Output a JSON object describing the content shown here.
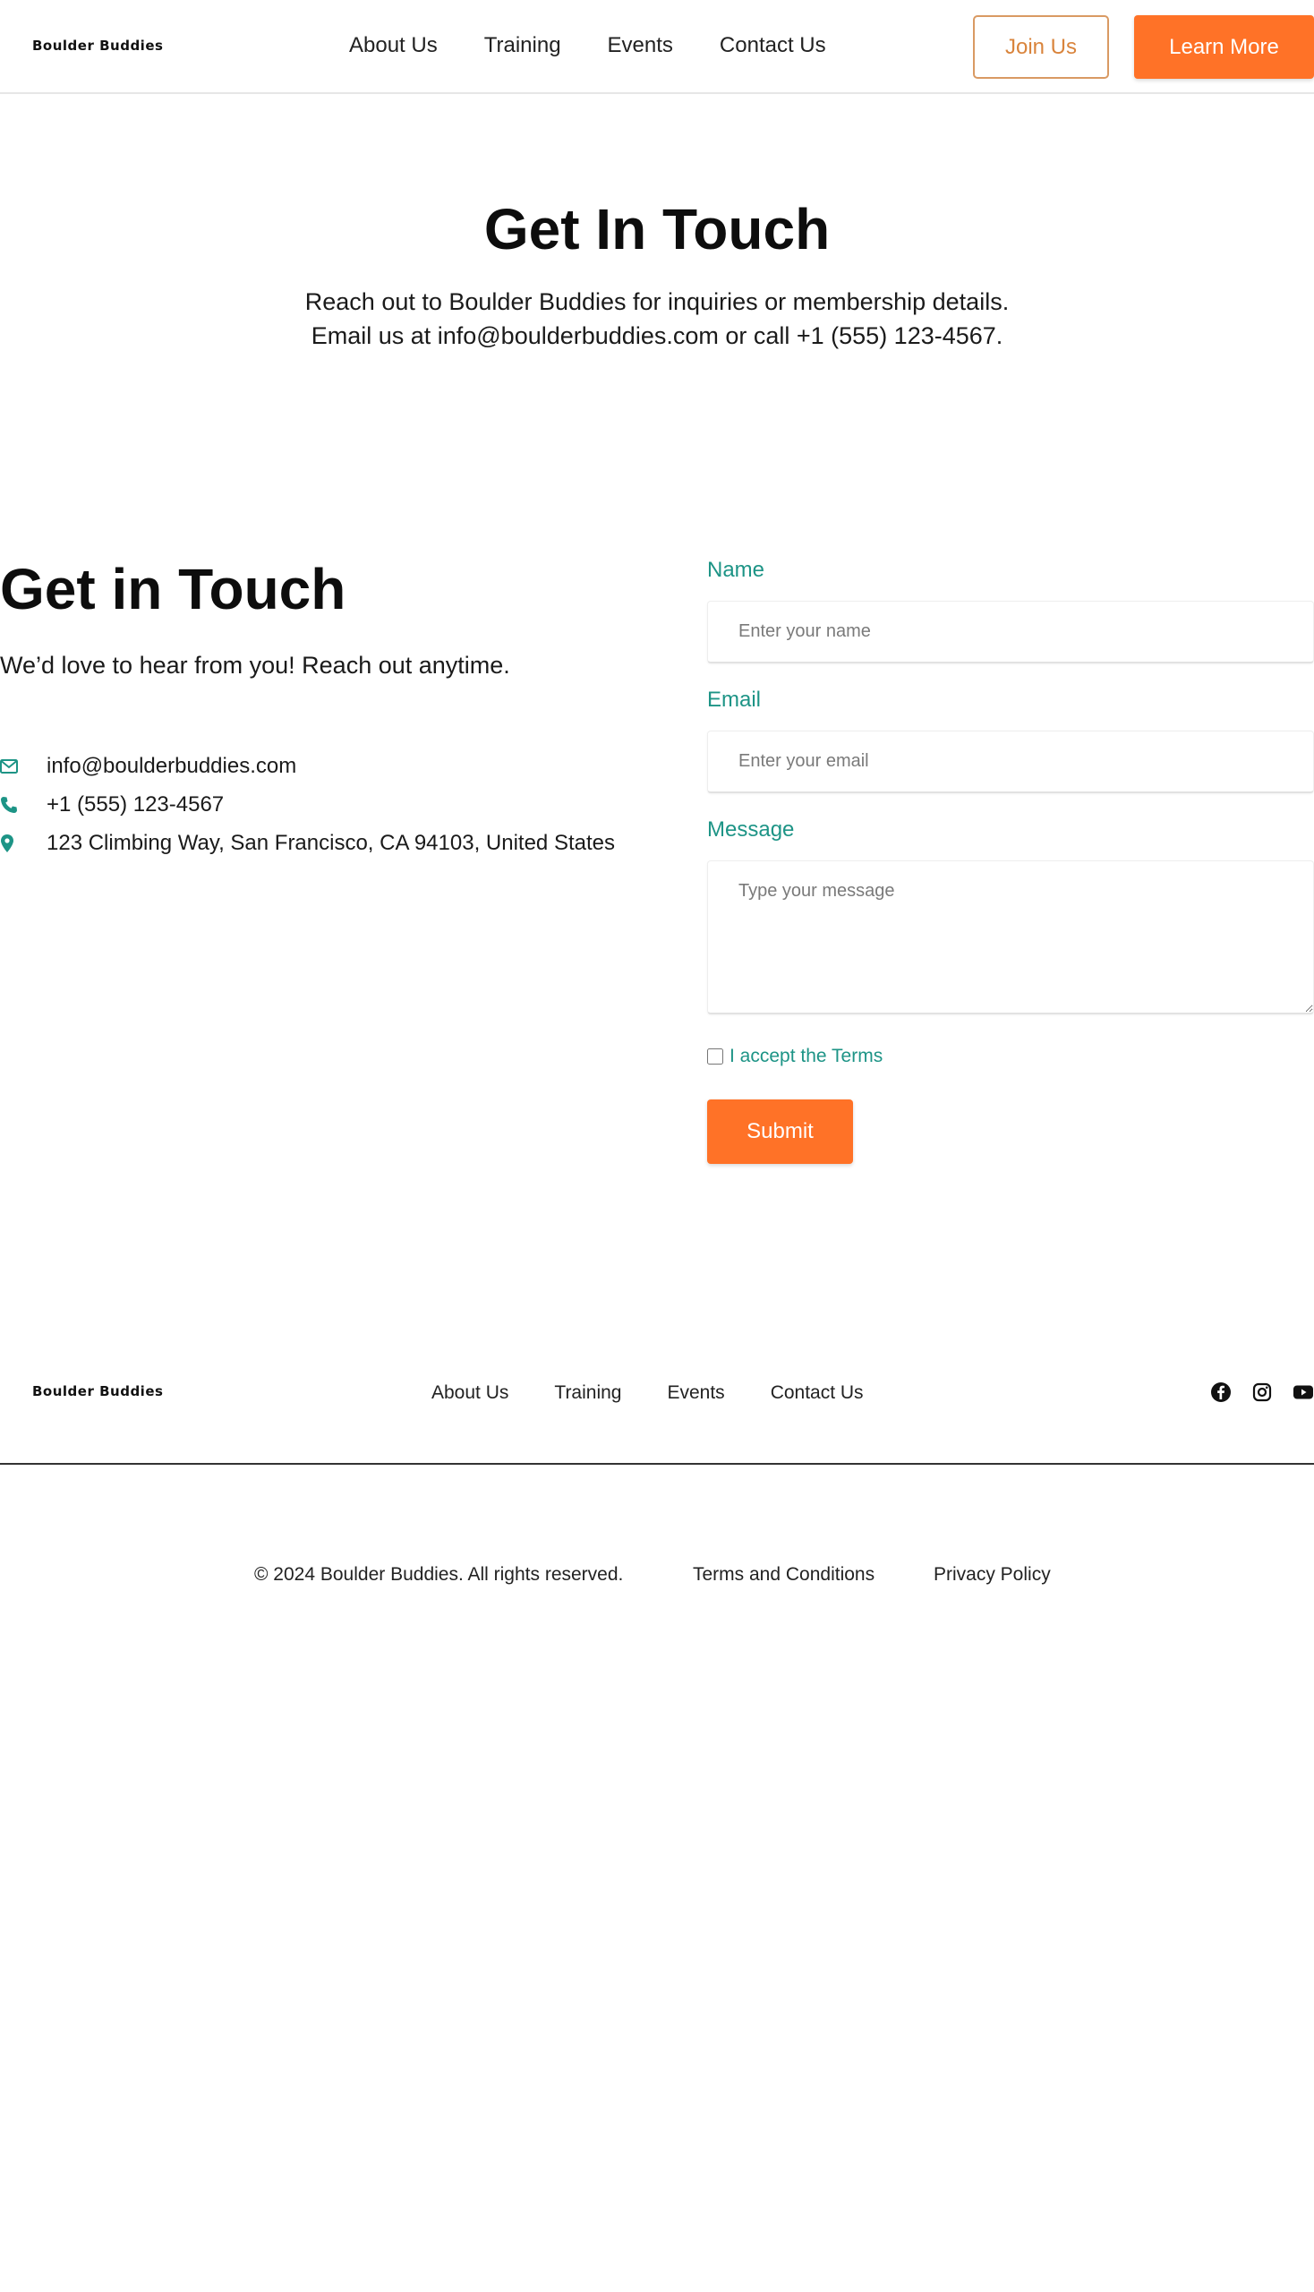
{
  "header": {
    "brand": "Boulder Buddies",
    "nav": [
      "About Us",
      "Training",
      "Events",
      "Contact Us"
    ],
    "join_label": "Join Us",
    "learn_label": "Learn More"
  },
  "hero": {
    "title": "Get In Touch",
    "line1": "Reach out to Boulder Buddies for inquiries or membership details.",
    "line2": "Email us at info@boulderbuddies.com or call +1 (555) 123-4567."
  },
  "contact": {
    "title": "Get in Touch",
    "subtitle": "We’d love to hear from you! Reach out anytime.",
    "email": "info@boulderbuddies.com",
    "phone": "+1 (555) 123-4567",
    "address": "123 Climbing Way, San Francisco, CA 94103, United States",
    "icon_color": "#1d9486"
  },
  "form": {
    "name_label": "Name",
    "name_placeholder": "Enter your name",
    "email_label": "Email",
    "email_placeholder": "Enter your email",
    "message_label": "Message",
    "message_placeholder": "Type your message",
    "terms_label": "I accept the Terms",
    "submit_label": "Submit"
  },
  "footer": {
    "brand": "Boulder Buddies",
    "nav": [
      "About Us",
      "Training",
      "Events",
      "Contact Us"
    ],
    "social": [
      "facebook-icon",
      "instagram-icon",
      "youtube-icon"
    ],
    "copyright": "© 2024 Boulder Buddies. All rights reserved.",
    "terms_link": "Terms and Conditions",
    "privacy_link": "Privacy Policy"
  },
  "colors": {
    "accent": "#ff7227",
    "teal": "#1d9486",
    "join_border": "#d99a63"
  }
}
